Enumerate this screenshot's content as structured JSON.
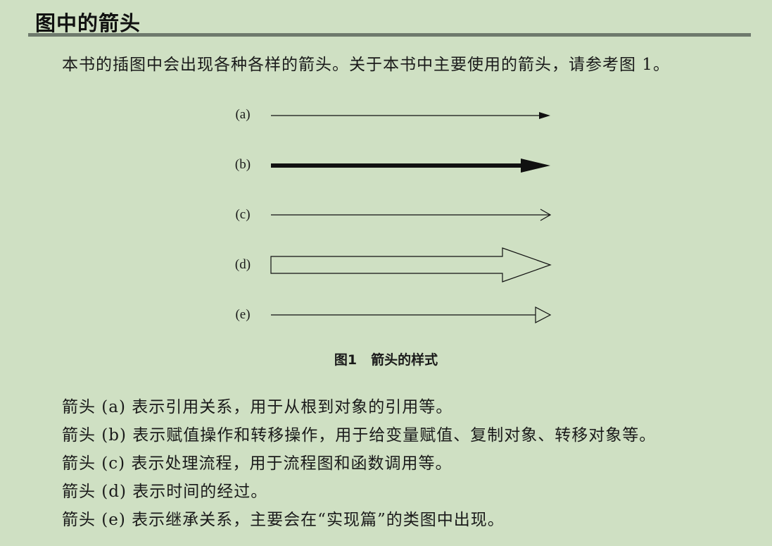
{
  "heading": "图中的箭头",
  "intro": "本书的插图中会出现各种各样的箭头。关于本书中主要使用的箭头，请参考图 1。",
  "figure": {
    "labels": [
      "(a)",
      "(b)",
      "(c)",
      "(d)",
      "(e)"
    ],
    "caption_number": "图1",
    "caption_text": "箭头的样式"
  },
  "descriptions": [
    "箭头 (a) 表示引用关系，用于从根到对象的引用等。",
    "箭头 (b) 表示赋值操作和转移操作，用于给变量赋值、复制对象、转移对象等。",
    "箭头 (c) 表示处理流程，用于流程图和函数调用等。",
    "箭头 (d) 表示时间的经过。",
    "箭头 (e) 表示继承关系，主要会在“实现篇”的类图中出现。"
  ]
}
